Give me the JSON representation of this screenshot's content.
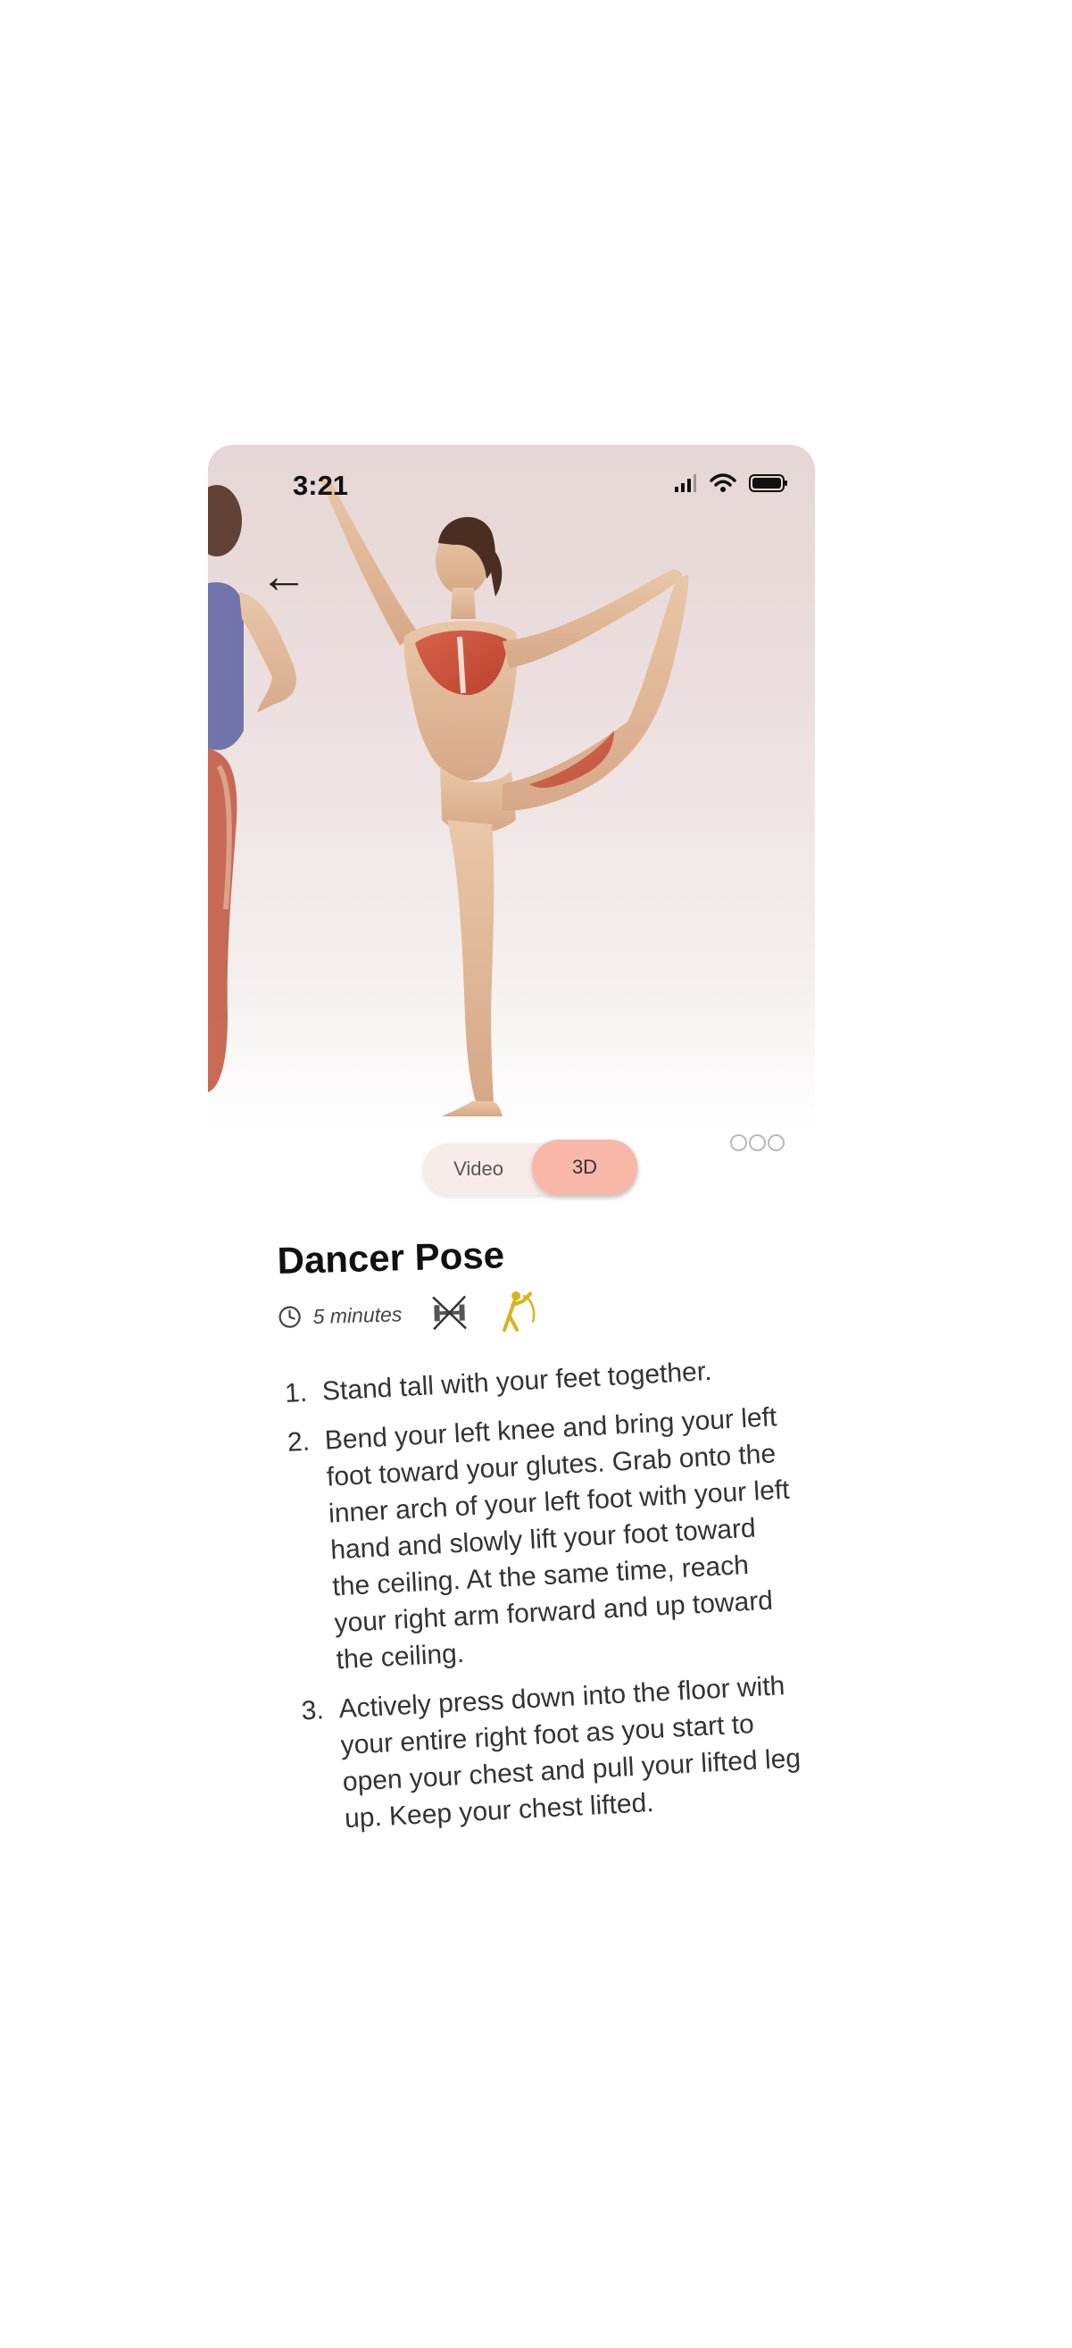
{
  "status_bar": {
    "time": "3:21"
  },
  "nav": {
    "back_glyph": "←"
  },
  "media_toggle": {
    "video_label": "Video",
    "threed_label": "3D",
    "selected": "3D"
  },
  "exercise": {
    "title": "Dancer Pose",
    "duration": "5 minutes",
    "steps": [
      {
        "num": "1.",
        "text": "Stand tall with your feet together."
      },
      {
        "num": "2.",
        "text": "Bend your left knee and bring your left foot toward your glutes. Grab onto the inner arch of your left foot with your left hand and slowly lift your foot toward the ceiling. At the same time, reach your right arm forward and up toward the ceiling."
      },
      {
        "num": "3.",
        "text": "Actively press down into the floor with your entire right foot as you start to open your chest and pull your lifted leg up. Keep your chest lifted."
      }
    ]
  },
  "icons": {
    "clock": "clock-icon",
    "no_equipment": "no-equipment-icon",
    "stretch": "stretch-figure-icon",
    "more": "more-dots-icon"
  },
  "colors": {
    "accent": "#f8b8a8",
    "toggle_bg": "#f7ece9",
    "stretch_icon": "#d9b31c"
  }
}
